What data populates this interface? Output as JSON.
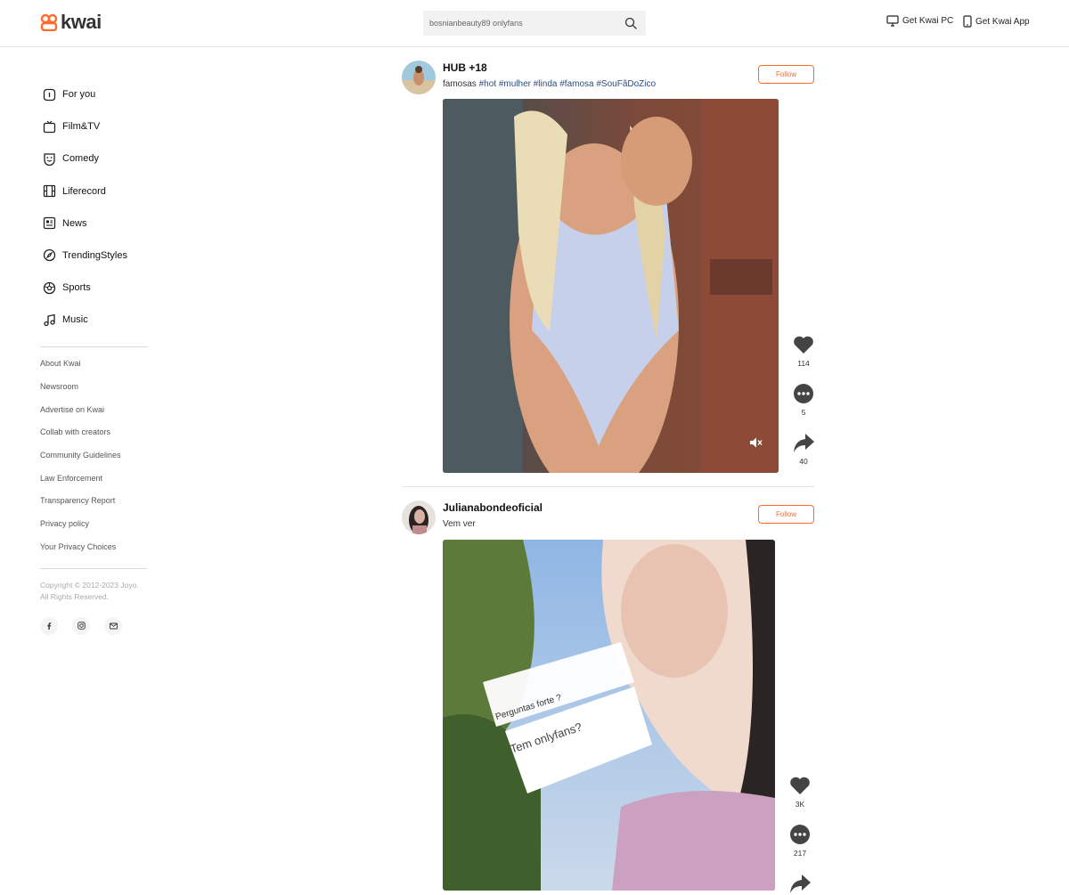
{
  "header": {
    "logo_text": "kwai",
    "search": {
      "value": "bosnianbeauty89 onlyfans",
      "placeholder": ""
    },
    "get_pc_label": "Get Kwai PC",
    "get_app_label": "Get Kwai App",
    "brand_color": "#ff6b2c"
  },
  "sidebar": {
    "nav": [
      {
        "label": "For you",
        "icon": "info-circle-icon"
      },
      {
        "label": "Film&TV",
        "icon": "tv-icon"
      },
      {
        "label": "Comedy",
        "icon": "smile-icon"
      },
      {
        "label": "Liferecord",
        "icon": "film-icon"
      },
      {
        "label": "News",
        "icon": "news-icon"
      },
      {
        "label": "TrendingStyles",
        "icon": "compass-icon"
      },
      {
        "label": "Sports",
        "icon": "soccer-ball-icon"
      },
      {
        "label": "Music",
        "icon": "music-note-icon"
      }
    ],
    "footer_links": [
      "About Kwai",
      "Newsroom",
      "Advertise on Kwai",
      "Collab with creators",
      "Community Guidelines",
      "Law Enforcement",
      "Transparency Report",
      "Privacy policy",
      "Your Privacy Choices"
    ],
    "copyright_line1": "Copyright © 2012-2023 Joyo.",
    "copyright_line2": "All Rights Reserved.",
    "socials": [
      "facebook-icon",
      "instagram-icon",
      "mail-icon"
    ]
  },
  "posts": [
    {
      "author": "HUB +18",
      "caption_text": "famosas",
      "tags": [
        "#hot",
        "#mulher",
        "#linda",
        "#famosa",
        "#SouFãDoZico"
      ],
      "follow_label": "Follow",
      "likes": "114",
      "comments": "5",
      "shares": "40",
      "muted": true
    },
    {
      "author": "Julianabondeoficial",
      "caption_text": "Vem ver",
      "tags": [],
      "follow_label": "Follow",
      "video_overlay_top": "Perguntas forte ?",
      "video_overlay_bottom": "Tem onlyfans?",
      "likes": "3K",
      "comments": "217"
    }
  ]
}
